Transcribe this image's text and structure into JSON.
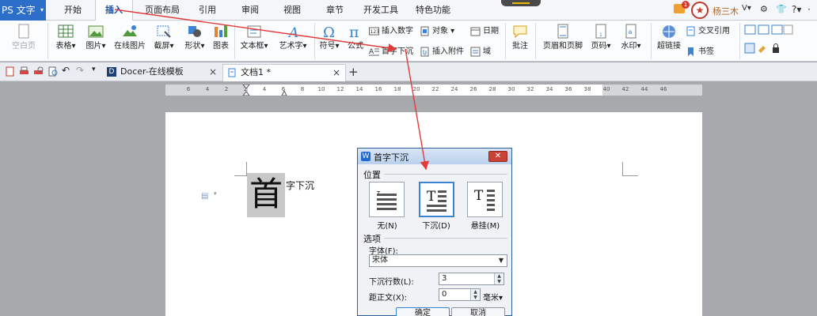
{
  "app": {
    "title": "PS 文字"
  },
  "menu": {
    "tabs": [
      "开始",
      "插入",
      "页面布局",
      "引用",
      "审阅",
      "视图",
      "章节",
      "开发工具",
      "特色功能"
    ],
    "active": "插入"
  },
  "user": {
    "name": "杨三木",
    "badge": "1",
    "help": "?"
  },
  "ribbon": {
    "blank_page": "空白页",
    "table": "表格",
    "picture": "图片",
    "online_picture": "在线图片",
    "screenshot": "截屏",
    "shape": "形状",
    "chart": "图表",
    "textbox": "文本框",
    "wordart": "艺术字",
    "symbol": "符号",
    "formula": "公式",
    "insert_number": "插入数字",
    "object": "对象",
    "date": "日期",
    "dropcap": "首字下沉",
    "attachment": "插入附件",
    "field": "域",
    "comment": "批注",
    "header_footer": "页眉和页脚",
    "page_number": "页码",
    "watermark": "水印",
    "hyperlink": "超链接",
    "cross_ref": "交叉引用",
    "bookmark": "书签"
  },
  "doc_tabs": [
    {
      "label": "Docer-在线模板"
    },
    {
      "label": "文档1 *"
    }
  ],
  "ruler_ticks": [
    "6",
    "4",
    "2",
    "2",
    "4",
    "6",
    "8",
    "10",
    "12",
    "14",
    "16",
    "18",
    "20",
    "22",
    "24",
    "26",
    "28",
    "30",
    "32",
    "34",
    "36",
    "38",
    "40",
    "42",
    "44",
    "46"
  ],
  "document": {
    "dropcap_char": "首",
    "rest_text": "字下沉"
  },
  "dialog": {
    "title": "首字下沉",
    "position_group": "位置",
    "positions": [
      {
        "label": "无(N)"
      },
      {
        "label": "下沉(D)"
      },
      {
        "label": "悬挂(M)"
      }
    ],
    "selected_position": "下沉(D)",
    "options_group": "选项",
    "font_label": "字体(F):",
    "font_value": "宋体",
    "lines_label": "下沉行数(L):",
    "lines_value": "3",
    "distance_label": "距正文(X):",
    "distance_value": "0",
    "distance_unit": "毫米",
    "ok": "确定",
    "cancel": "取消"
  },
  "colors": {
    "app_blue": "#2d6ec9",
    "arrow_red": "#e23b3b",
    "dialog_border": "#2f5f9c",
    "close_red": "#c94235"
  }
}
